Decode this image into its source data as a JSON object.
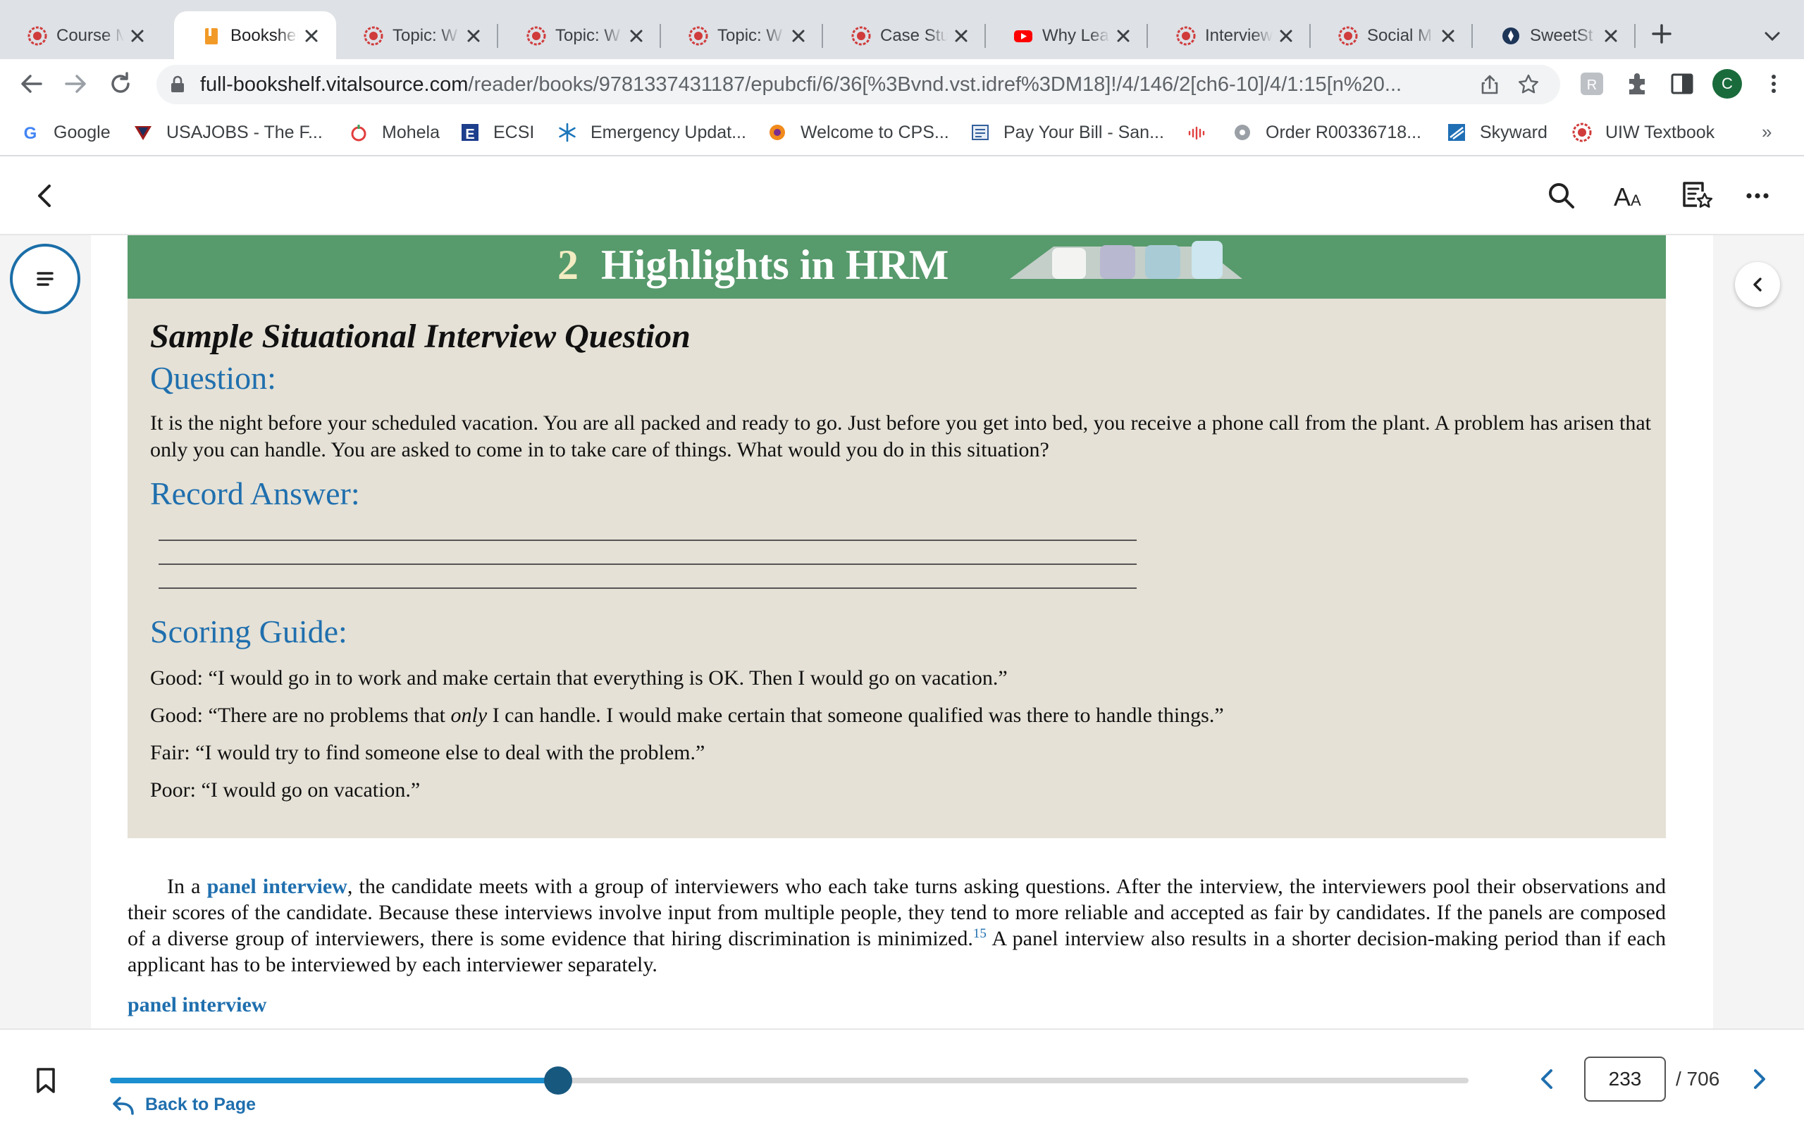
{
  "browser": {
    "tabs": [
      {
        "title": "Course M",
        "favicon": "uiw-seal-icon",
        "active": false
      },
      {
        "title": "Bookshel",
        "favicon": "bookshelf-icon",
        "active": true
      },
      {
        "title": "Topic: W",
        "favicon": "uiw-seal-icon",
        "active": false
      },
      {
        "title": "Topic: W",
        "favicon": "uiw-seal-icon",
        "active": false
      },
      {
        "title": "Topic: W",
        "favicon": "uiw-seal-icon",
        "active": false
      },
      {
        "title": "Case Stu",
        "favicon": "uiw-seal-icon",
        "active": false
      },
      {
        "title": "Why Lea",
        "favicon": "youtube-icon",
        "active": false
      },
      {
        "title": "Interview",
        "favicon": "uiw-seal-icon",
        "active": false
      },
      {
        "title": "Social M",
        "favicon": "uiw-seal-icon",
        "active": false
      },
      {
        "title": "SweetSt",
        "favicon": "sweetstudy-icon",
        "active": false
      }
    ],
    "url_host": "full-bookshelf.vitalsource.com",
    "url_path": "/reader/books/9781337431187/epubcfi/6/36[%3Bvnd.vst.idref%3DM18]!/4/146/2[ch6-10]/4/1:15[n%20...",
    "profile_initial": "C",
    "bookmarks": [
      {
        "label": "Google",
        "icon": "google-icon"
      },
      {
        "label": "USAJOBS - The F...",
        "icon": "usajobs-icon"
      },
      {
        "label": "Mohela",
        "icon": "mohela-icon"
      },
      {
        "label": "ECSI",
        "icon": "ecsi-icon"
      },
      {
        "label": "Emergency Updat...",
        "icon": "snowflake-icon"
      },
      {
        "label": "Welcome to CPS...",
        "icon": "cps-icon"
      },
      {
        "label": "Pay Your Bill - San...",
        "icon": "bill-icon"
      },
      {
        "label": "",
        "icon": "cisco-icon"
      },
      {
        "label": "Order R00336718...",
        "icon": "order-icon"
      },
      {
        "label": "Skyward",
        "icon": "skyward-icon"
      },
      {
        "label": "UIW Textbook",
        "icon": "uiw-seal-icon"
      }
    ],
    "bookmarks_overflow": "»"
  },
  "reader": {
    "banner": {
      "number": "2",
      "title": "Highlights in HRM"
    },
    "box": {
      "title": "Sample Situational Interview Question",
      "question_heading": "Question:",
      "question_text": "It is the night before your scheduled vacation. You are all packed and ready to go. Just before you get into bed, you receive a phone call from the plant. A problem has arisen that only you can handle. You are asked to come in to take care of things. What would you do in this situation?",
      "record_heading": "Record Answer:",
      "scoring_heading": "Scoring Guide:",
      "guide": [
        {
          "text": "Good: “I would go in to work and make certain that everything is OK. Then I would go on vacation.”"
        },
        {
          "before": "Good: “There are no problems that ",
          "italic": "only",
          "after": " I can handle. I would make certain that someone qualified was there to handle things.”"
        },
        {
          "text": "Fair: “I would try to find someone else to deal with the problem.”"
        },
        {
          "text": "Poor: “I would go on vacation.”"
        }
      ]
    },
    "paragraph": {
      "lead": "In a ",
      "term": "panel interview",
      "text1": ", the candidate meets with a group of interviewers who each take turns asking questions. After the interview, the interviewers pool their observations and their scores of the candidate. Because these interviews involve input from multiple people, they tend to more reliable and accepted as fair by candidates. If the panels are composed of a diverse group of interviewers, there is some evidence that hiring discrimination is minimized.",
      "footnote": "15",
      "text2": " A panel interview also results in a shorter decision-making period than if each applicant has to be interviewed by each interviewer separately."
    },
    "glossary_term": "panel interview",
    "navigation": {
      "back_label": "Back to Page",
      "current_page": "233",
      "total_label": "/ 706",
      "progress": 0.3299
    }
  },
  "colors": {
    "accent": "#1f6fae",
    "banner_green": "#579a6c",
    "box_bg": "#e5e1d6",
    "slider_fill": "#1b8fcf",
    "slider_thumb": "#17587f"
  }
}
